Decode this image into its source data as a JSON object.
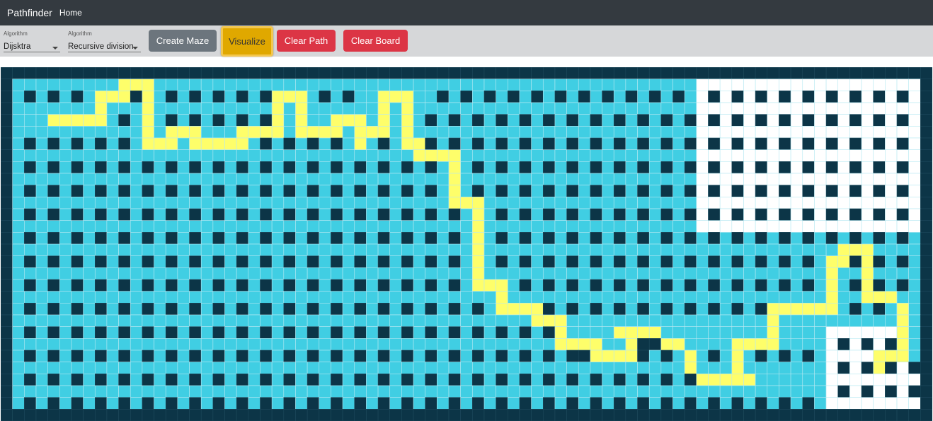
{
  "navbar": {
    "brand": "Pathfinder",
    "home": "Home"
  },
  "toolbar": {
    "algorithm_select": {
      "label": "Algorithm",
      "value": "Dijsktra"
    },
    "maze_select": {
      "label": "Algorithm",
      "value": "Recursive division"
    },
    "create_maze_label": "Create Maze",
    "visualize_label": "Visualize",
    "clear_path_label": "Clear Path",
    "clear_board_label": "Clear Board"
  },
  "colors": {
    "navbar": "#343a40",
    "toolbar": "#d6d7d9",
    "wall": "#0c3547",
    "visited": "#40cee3",
    "unvisited": "#ffffff",
    "path": "#fefe6a",
    "btn_secondary": "#6c757d",
    "btn_warning": "#e0a800",
    "btn_danger": "#dc3545"
  },
  "grid": {
    "rows": 30,
    "cols": 79,
    "rows_data": [
      "WWWWWWWWWWWWWWWWWWWWWWWWWWWWWWWWWWWWWWWWWWWWWWWWWWWWWWWWWWWWWWWWWWWWWWWWWWWWWWW",
      "WVVVVVVVVVPPPVVVVVVVVVVVVVVVVVVVVVVVVVVVVVVVVVVVVVVVVVVVVVVUUUUUUUUUUUUUUUUUUUW",
      "WVWVWVWVPPPWPVWVWVWVWVWPPPVWVWVVPPPVVWVWVWVWVWVWVWVWVWVWVWVUWUWUWUWUWUWUWUWUWUW",
      "WVVVVVVVPVVVPVVVVVVVVVVPVPVVVVVVPVPVVVVVVVVVVVVVVVVVVVVVVVVUUUUUUUUUUUUUUUUUUUW",
      "WVVVPPPPPVWVPVWVWVWVWVWPVPVVPPPVPVPVWVWVWVWVWVWVWVWVWVWVWVWUWUWUWUWUWUWUWUWUWUW",
      "WVVVVVVVVVVVPVPPPVVVPPPPVPPPPVPPPVPVVVVVVVVVVVVVVVVVVVVVVVVUUUUUUUUUUUUUUUUUUUW",
      "WVWVWVWVWVWVPPPVPPPPPVWVWVWVWVPVWVPPWVWVWVWVWVWVWVWVWVWVWVWUWUWUWUWUWUWUWUWUWUW",
      "WVVVVVVVVVVVVVVVVVVVVVVVVVVVVVVVVVVPPPPVVVVVVVVVVVVVVVVVVVVUUUUUUUUUUUUUUUUUUUW",
      "WVWVWVWVWVWVWVWVWVWVWVWVWVWVWVWVWVWVWVPVWVWVWVWVWVWVWVWVWVWUWUWUWUWUWUWUWUWUWUW",
      "WVVVVVVVVVVVVVVVVVVVVVVVVVVVVVVVVVVVVVPVVVVVVVVVVVVVVVVVVVVUUUUUUUUUUUUUUUUUUUW",
      "WVWVWVWVWVWVWVWVWVWVWVWVWVWVWVWVWVWVWVPVWVWVWVWVWVWVWVWVWVWUWUWUWUWUWUWUWUWUWUW",
      "WVVVVVVVVVVVVVVVVVVVVVVVVVVVVVVVVVVVVVPPPVVVVVVVVVVVVVVVVVVUUUUUUUUUUUUUUUUUUUW",
      "WVWVWVWVWVWVWVWVWVWVWVWVWVWVWVWVWVWVWVWVPVWVWVWVWVWVWVWVWVWUWUWUWUWUWUWUWUWUWUW",
      "WVVVVVVVVVVVVVVVVVVVVVVVVVVVVVVVVVVVVVVVPVVVVVVVVVVVVVVVVVVUUUUUUUUUUUUUUUUUUUW",
      "WVWVWVWVWVWVWVWVWVWVWVWVWVWVWVWVWVWVWVWVPVWVWVWVWVWVWVWVWVWVWVWVWVWVWVWVWVWVWVW",
      "WVVVVVVVVVVVVVVVVVVVVVVVVVVVVVVVVVVVVVVVPVVVVVVVVVVVVVVVVVVVVVVVVVVVVVVPPPVVVVW",
      "WVWVWVWVWVWVWVWVWVWVWVWVWVWVWVWVWVWVWVWVPVWVWVWVWVWVWVWVWVWVWVWVWVWVWVPPWPWVWVW",
      "WVVVVVVVVVVVVVVVVVVVVVVVVVVVVVVVVVVVVVVVPVVVVVVVVVVVVVVVVVVVVVVVVVVVVVPVVPVVVVW",
      "WVWVWVWVWVWVWVWVWVWVWVWVWVWVWVWVWVWVWVWVPPPVWVWVWVWVWVWVWVWVWVWVWVWVWVPVWPWVWVW",
      "WVVVVVVVVVVVVVVVVVVVVVVVVVVVVVVVVVVVVVVVVVPVVVVVVVVVVVVVVVVVVVVVVVVVVVPVVPPPVVW",
      "WVWVWVWVWVWVWVWVWVWVWVWVWVWVWVWVWVWVWVWVWVPPPPWVWVWVWVWVWVWVWVWVWPPPPPPVWVWVPVW",
      "WVVVVVVVVVVVVVVVVVVVVVVVVVVVVVVVVVVVVVVVVVVVVPPPVVVVVVVVVVVVVVVVVPVVVVVVVVVVPVW",
      "WVWVWVWVWVWVWVWVWVWVWVWVWVWVWVWVWVWVWVWVWVWVWVWPVVVVPPPPVVVVVVVVVPVVVVUUUUUUPVW",
      "WVVVVVVVVVVVVVVVVVVVVVVVVVVVVVVVVVVVVVVVVVVVVVVPPPPVVPWWPPVVVVPPPPVVVVUWUWUWPVW",
      "WVWVWVWVWVWVWVWVWVWVWVWVWVWVWVWVWVWVWVWVWVWVWVWVWWPPPPWVWVPVWVPVWVWVWVUUUUPPPVW",
      "WVVVVVVVVVVVVVVVVVVVVVVVVVVVVVVVVVVVVVVVVVVVVVVVVVVVVVVVVVPVVVPVVVVVVVUWUWPWUWW",
      "WVWVWVWVWVWVWVWVWVWVWVWVWVWVWVWVWVWVWVWVWVWVWVWVWVWVWVWVWVWPPPPPVVVVVVUUUUUUUUW",
      "WVVVVVVVVVVVVVVVVVVVVVVVVVVVVVVVVVVVVVVVVVVVVVVVVVVVVVVVVVVVVVVVVVVVVVUWUWUWUWW",
      "WVWVWVWVWVWVWVWVWVWVWVWVWVWVWVWVWVWVWVWVWVWVWVWVWVWVWVWVWVWVWVWVWVWVWVUUUUUUUUW",
      "WWWWWWWWWWWWWWWWWWWWWWWWWWWWWWWWWWWWWWWWWWWWWWWWWWWWWWWWWWWWWWWWWWWWWWWWWWWWWWW"
    ]
  }
}
